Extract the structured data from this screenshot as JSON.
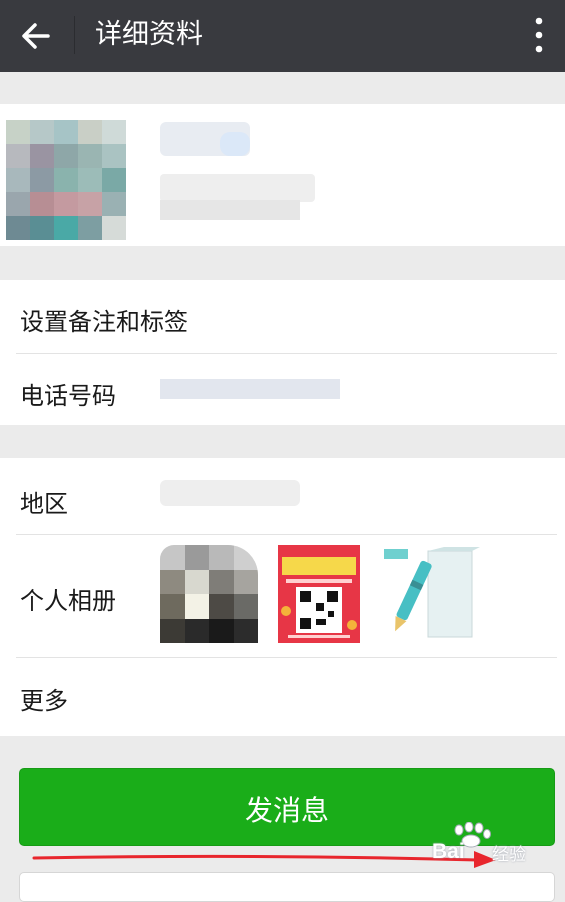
{
  "header": {
    "title": "详细资料"
  },
  "rows": {
    "remark_tag": "设置备注和标签",
    "phone": "电话号码",
    "region": "地区",
    "album": "个人相册",
    "more": "更多"
  },
  "actions": {
    "send_message": "发消息"
  },
  "watermark": {
    "brand": "Bai",
    "text": "经验"
  },
  "colors": {
    "header_bg": "#393a3f",
    "send_button": "#1aad19",
    "page_bg": "#ebebeb",
    "annotation_arrow": "#e8262d"
  }
}
